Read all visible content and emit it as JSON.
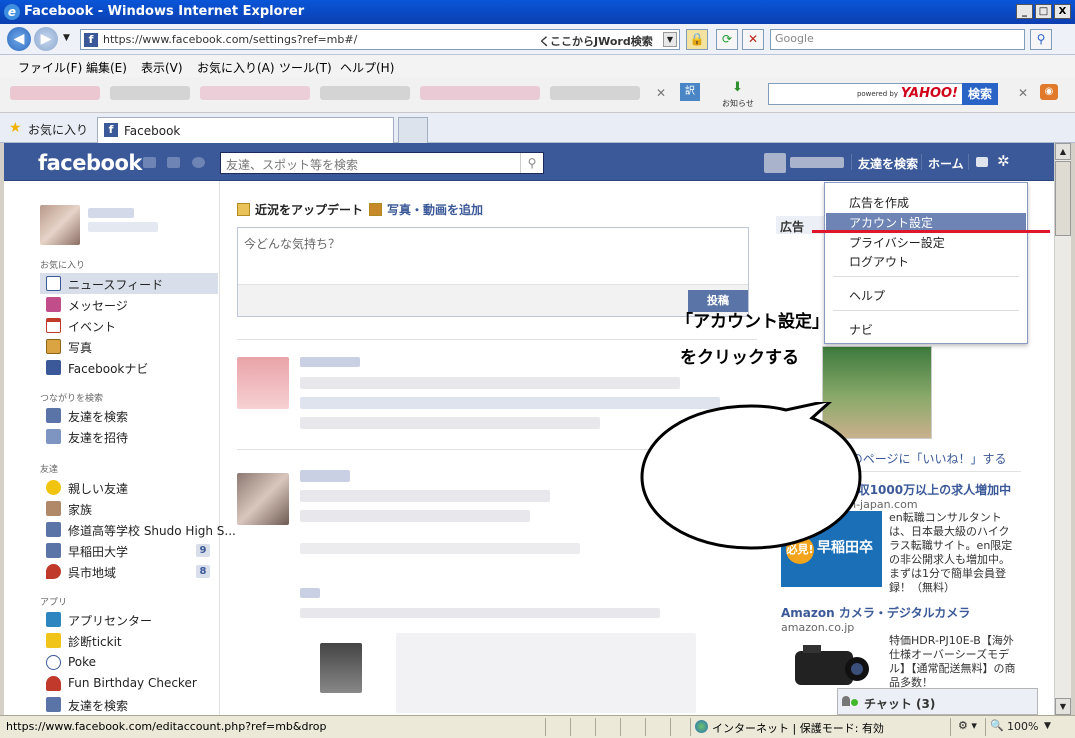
{
  "window": {
    "title": "Facebook - Windows Internet Explorer",
    "min_label": "_",
    "max_label": "□",
    "close_label": "X"
  },
  "address_bar": {
    "url": "https://www.facebook.com/settings?ref=mb#/",
    "jword": "くここからJWord検索",
    "search_placeholder": "Google"
  },
  "menu": {
    "items": [
      "ファイル(F)",
      "編集(E)",
      "表示(V)",
      "お気に入り(A)",
      "ツール(T)",
      "ヘルプ(H)"
    ]
  },
  "toolbar2": {
    "oshirase": "お知らせ",
    "yahoo_powered": "powered by",
    "yahoo_logo": "YAHOO!",
    "yahoo_search": "検索"
  },
  "favorites": {
    "label": "お気に入り",
    "tab_title": "Facebook"
  },
  "facebook": {
    "logo": "facebook",
    "search_placeholder": "友達、スポット等を検索",
    "nav": {
      "find_friends": "友達を検索",
      "home": "ホーム"
    },
    "dropdown": {
      "items": [
        "広告を作成",
        "アカウント設定",
        "プライバシー設定",
        "ログアウト",
        "ヘルプ",
        "ナビ"
      ]
    },
    "sidebar": {
      "favorites_header": "お気に入り",
      "favorites": [
        {
          "label": "ニュースフィード"
        },
        {
          "label": "メッセージ"
        },
        {
          "label": "イベント"
        },
        {
          "label": "写真"
        },
        {
          "label": "Facebookナビ"
        }
      ],
      "connect_header": "つながりを検索",
      "connect": [
        {
          "label": "友達を検索"
        },
        {
          "label": "友達を招待"
        }
      ],
      "friends_header": "友達",
      "friends": [
        {
          "label": "親しい友達"
        },
        {
          "label": "家族"
        },
        {
          "label": "修道高等学校 Shudo High S..."
        },
        {
          "label": "早稲田大学",
          "count": "9"
        },
        {
          "label": "呉市地域",
          "count": "8"
        }
      ],
      "apps_header": "アプリ",
      "apps": [
        {
          "label": "アプリセンター"
        },
        {
          "label": "診断tickit"
        },
        {
          "label": "Poke"
        },
        {
          "label": "Fun Birthday Checker"
        },
        {
          "label": "友達を検索"
        }
      ]
    },
    "composer": {
      "update_status": "近況をアップデート",
      "add_photo": "写真・動画を追加",
      "placeholder": "今どんな気持ち？",
      "post_button": "投稿"
    },
    "ads": {
      "header": "広告",
      "like_page": "このページに「いいね！」する",
      "ad1": {
        "title": "30代必見、年収1000万以上の求人増加中",
        "source": "consultant.en-japan.com",
        "text": "en転職コンサルタントは、日本最大級のハイクラス転職サイト。en限定の非公開求人も増加中。まずは1分で簡単会員登録！（無料）",
        "img_badge": "必見!",
        "img_text": "早稲田卒"
      },
      "ad2": {
        "title": "Amazon カメラ・デジタルカメラ",
        "source": "amazon.co.jp",
        "text": "特価HDR-PJ10E-B【海外仕様オーバーシーズモデル】【通常配送無料】の商品多数！"
      }
    },
    "chat": "チャット (3)"
  },
  "callout": {
    "line1": "「アカウント設定」",
    "line2": "をクリックする"
  },
  "statusbar": {
    "url": "https://www.facebook.com/editaccount.php?ref=mb&drop",
    "zone": "インターネット | 保護モード: 有効",
    "zoom": "100%"
  },
  "colors": {
    "fb_blue": "#3b5998",
    "highlight": "#6d84b4",
    "red_underline": "#e0162b"
  }
}
